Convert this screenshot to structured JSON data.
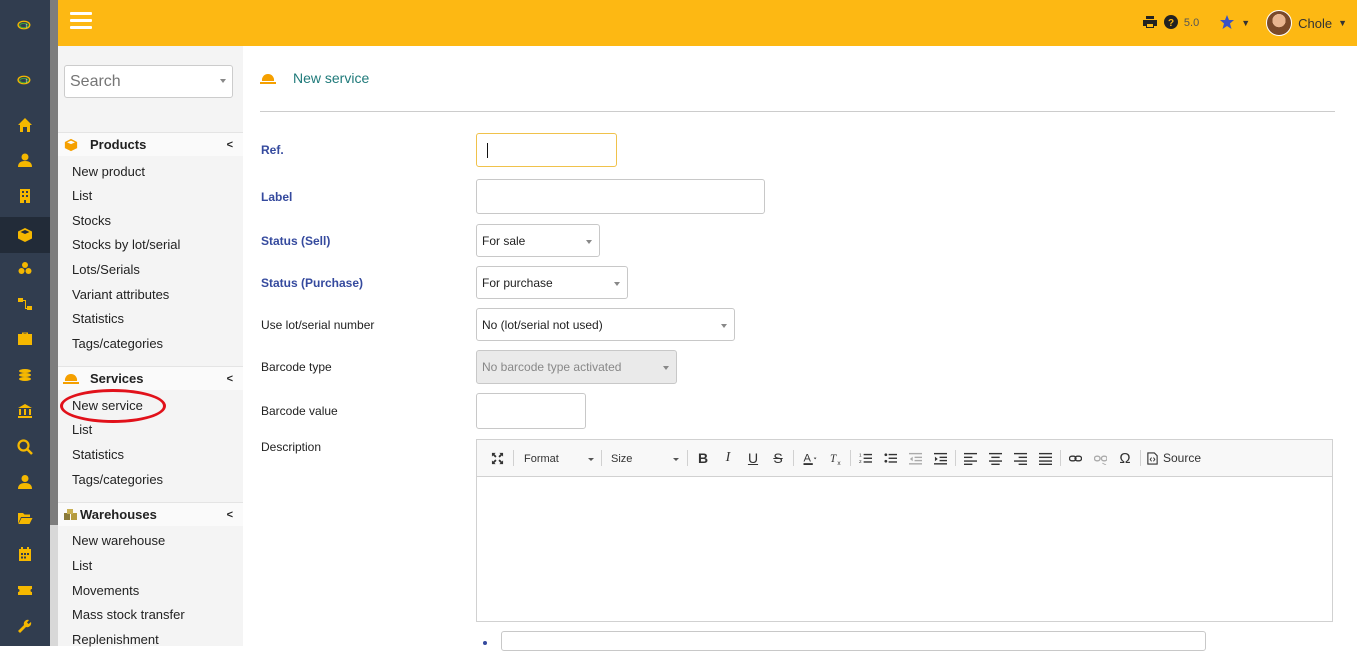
{
  "colors": {
    "topbar": "#fdb813",
    "rail": "#313d4f",
    "accent": "#f5b800",
    "label_required": "#354a9e",
    "title": "#1f7a7a",
    "annotation": "#e1111a"
  },
  "topbar": {
    "version": "5.0",
    "user": "Chole"
  },
  "search": {
    "placeholder": "Search"
  },
  "menu": {
    "products": {
      "title": "Products",
      "icon": "cube-icon",
      "items": [
        "New product",
        "List",
        "Stocks",
        "Stocks by lot/serial",
        "Lots/Serials",
        "Variant attributes",
        "Statistics",
        "Tags/categories"
      ]
    },
    "services": {
      "title": "Services",
      "icon": "bell-icon",
      "items": [
        "New service",
        "List",
        "Statistics",
        "Tags/categories"
      ]
    },
    "warehouses": {
      "title": "Warehouses",
      "icon": "boxes-icon",
      "items": [
        "New warehouse",
        "List",
        "Movements",
        "Mass stock transfer",
        "Replenishment"
      ]
    }
  },
  "page": {
    "title": "New service"
  },
  "form": {
    "ref": {
      "label": "Ref.",
      "value": ""
    },
    "label": {
      "label": "Label",
      "value": ""
    },
    "status_sell": {
      "label": "Status (Sell)",
      "value": "For sale"
    },
    "status_purchase": {
      "label": "Status (Purchase)",
      "value": "For purchase"
    },
    "lot_serial": {
      "label": "Use lot/serial number",
      "value": "No (lot/serial not used)"
    },
    "barcode_type": {
      "label": "Barcode type",
      "value": "No barcode type activated"
    },
    "barcode_value": {
      "label": "Barcode value",
      "value": ""
    },
    "description": {
      "label": "Description"
    }
  },
  "editor": {
    "format": "Format",
    "size": "Size",
    "source": "Source",
    "b": "B",
    "i": "I",
    "u": "U",
    "s": "S",
    "omega": "Ω"
  }
}
